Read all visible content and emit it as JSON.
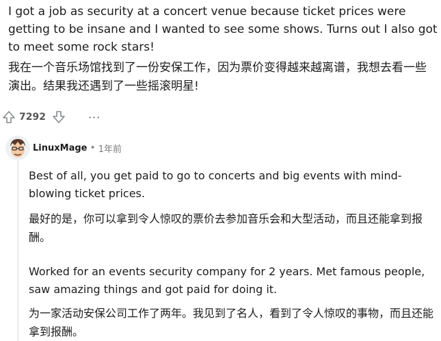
{
  "post": {
    "text_en": "I got a job as security at a concert venue because ticket prices were getting to be insane and I wanted to see some shows. Turns out I also got to meet some rock stars!",
    "text_zh": "我在一个音乐场馆找到了一份安保工作，因为票价变得越来越离谱，我想去看一些演出。结果我还遇到了一些摇滚明星!"
  },
  "votes": {
    "count": "7292",
    "more": "···",
    "upvote_icon": "arrow-up-icon",
    "downvote_icon": "arrow-down-icon"
  },
  "comment": {
    "username": "LinuxMage",
    "separator": "•",
    "time": "1年前",
    "paragraphs": [
      "Best of all, you get paid to go to concerts and big events with mind-blowing ticket prices.",
      "最好的是，你可以拿到令人惊叹的票价去参加音乐会和大型活动，而且还能拿到报酬。",
      "Worked for an events security company for 2 years. Met famous people, saw amazing things and got paid for doing it.",
      "为一家活动安保公司工作了两年。我见到了名人，看到了令人惊叹的事物，而且还能拿到报酬。"
    ]
  },
  "colors": {
    "text": "#1c1c1c",
    "meta": "#878a8c",
    "thread": "#d8dadc"
  }
}
